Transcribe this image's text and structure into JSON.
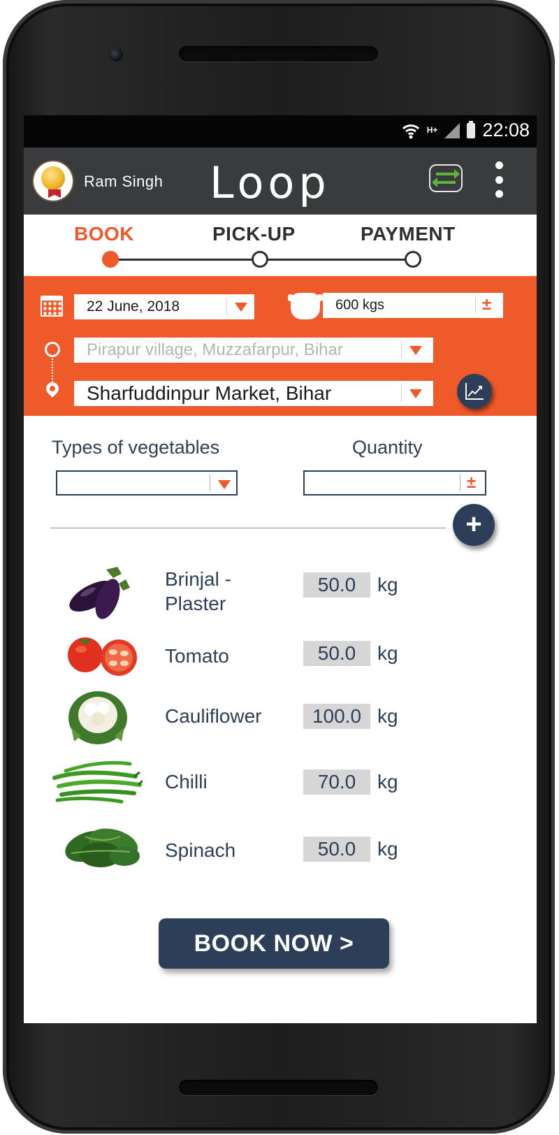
{
  "status": {
    "time": "22:08",
    "network": "H+"
  },
  "header": {
    "user_name": "Ram Singh",
    "app_title": "Loop"
  },
  "steps": [
    {
      "label": "BOOK",
      "active": true
    },
    {
      "label": "PICK-UP",
      "active": false
    },
    {
      "label": "PAYMENT",
      "active": false
    }
  ],
  "booking": {
    "date": "22 June, 2018",
    "weight": "600 kgs",
    "pickup_placeholder": "Pirapur village, Muzzafarpur, Bihar",
    "destination": "Sharfuddinpur Market, Bihar"
  },
  "form": {
    "types_label": "Types of vegetables",
    "quantity_label": "Quantity",
    "types_value": "",
    "quantity_value": "",
    "plus_minus": "±",
    "add_label": "+"
  },
  "items": [
    {
      "name": "Brinjal - Plaster",
      "qty": "50.0",
      "unit": "kg",
      "icon": "brinjal-icon"
    },
    {
      "name": "Tomato",
      "qty": "50.0",
      "unit": "kg",
      "icon": "tomato-icon"
    },
    {
      "name": "Cauliflower",
      "qty": "100.0",
      "unit": "kg",
      "icon": "cauliflower-icon"
    },
    {
      "name": "Chilli",
      "qty": "70.0",
      "unit": "kg",
      "icon": "chilli-icon"
    },
    {
      "name": "Spinach",
      "qty": "50.0",
      "unit": "kg",
      "icon": "spinach-icon"
    }
  ],
  "book_button": "BOOK NOW >",
  "colors": {
    "accent": "#ef5a2a",
    "navy": "#2d3f58",
    "appbar": "#3a3b3d",
    "green": "#5fb43a"
  }
}
